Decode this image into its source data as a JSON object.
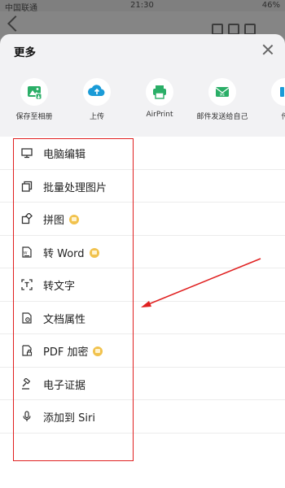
{
  "statusbar": {
    "carrier": "中国联通",
    "time": "21:30",
    "battery": "46%"
  },
  "sheet": {
    "title": "更多"
  },
  "share": [
    {
      "label": "保存至相册",
      "icon": "save-to-album-icon",
      "color": "#2aae67"
    },
    {
      "label": "上传",
      "icon": "upload-cloud-icon",
      "color": "#1a9bd7"
    },
    {
      "label": "AirPrint",
      "icon": "printer-icon",
      "color": "#2aae67"
    },
    {
      "label": "邮件发送给自己",
      "icon": "mail-me-icon",
      "color": "#2aae67"
    },
    {
      "label": "传",
      "icon": "transfer-icon",
      "color": "#1a9bd7"
    }
  ],
  "menu": [
    {
      "label": "电脑编辑",
      "icon": "monitor-icon",
      "vip": false
    },
    {
      "label": "批量处理图片",
      "icon": "batch-copy-icon",
      "vip": false
    },
    {
      "label": "拼图",
      "icon": "puzzle-icon",
      "vip": true
    },
    {
      "label": "转 Word",
      "icon": "word-doc-icon",
      "vip": true
    },
    {
      "label": "转文字",
      "icon": "text-scan-icon",
      "vip": false
    },
    {
      "label": "文档属性",
      "icon": "doc-properties-icon",
      "vip": false
    },
    {
      "label": "PDF 加密",
      "icon": "pdf-lock-icon",
      "vip": true
    },
    {
      "label": "电子证据",
      "icon": "gavel-icon",
      "vip": false
    },
    {
      "label": "添加到 Siri",
      "icon": "microphone-icon",
      "vip": false
    }
  ],
  "colors": {
    "accent_red": "#e02020",
    "vip_gold": "#f1c24d"
  }
}
